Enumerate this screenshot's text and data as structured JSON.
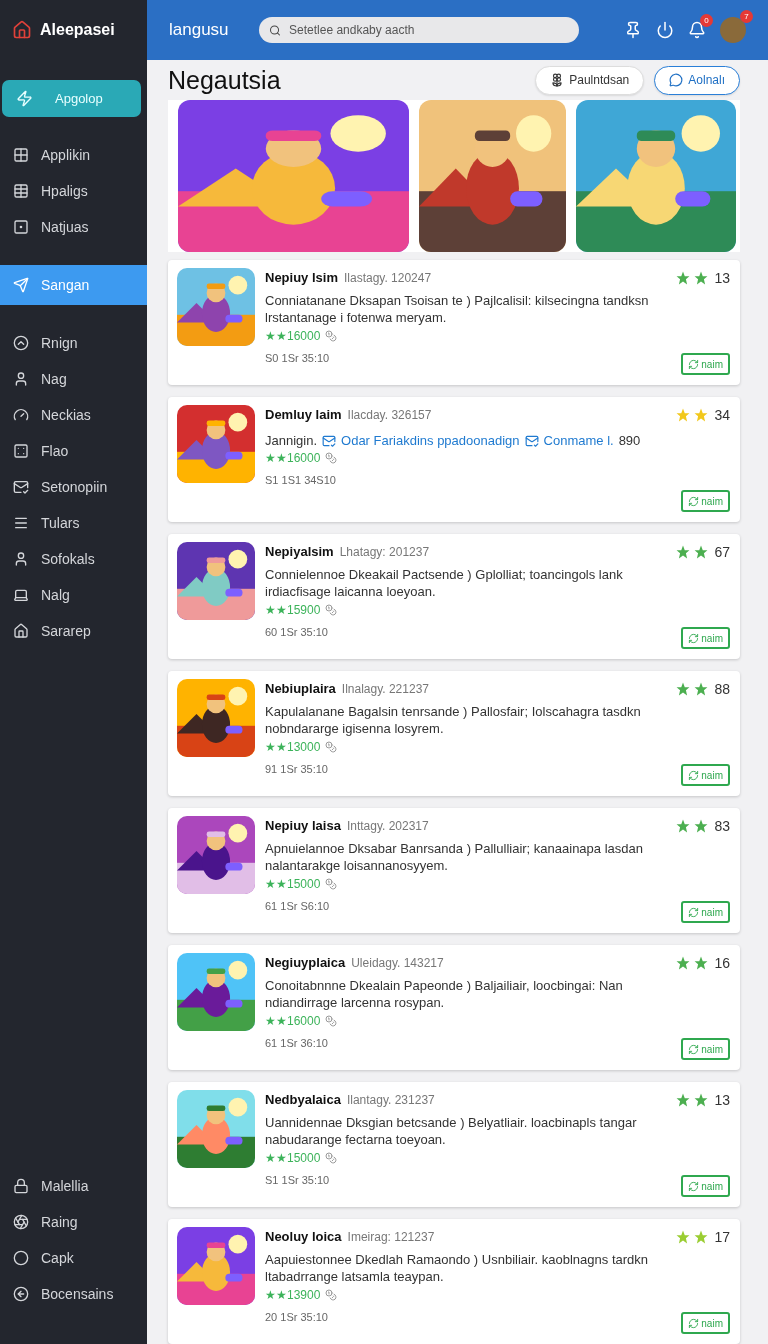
{
  "sidebar": {
    "brand": "Aleepasei",
    "primary_button": "Apgolop",
    "groups": [
      [
        {
          "label": "Applikin",
          "selected": false
        },
        {
          "label": "Hpaligs",
          "selected": false
        },
        {
          "label": "Natjuas",
          "selected": false
        }
      ],
      [
        {
          "label": "Sangan",
          "selected": true
        }
      ],
      [
        {
          "label": "Rnign",
          "selected": false
        },
        {
          "label": "Nag",
          "selected": false
        },
        {
          "label": "Neckias",
          "selected": false
        },
        {
          "label": "Flao",
          "selected": false
        },
        {
          "label": "Setonopiin",
          "selected": false
        },
        {
          "label": "Tulars",
          "selected": false
        },
        {
          "label": "Sofokals",
          "selected": false
        },
        {
          "label": "Nalg",
          "selected": false
        },
        {
          "label": "Sararep",
          "selected": false
        }
      ]
    ],
    "bottom_items": [
      {
        "label": "Malellia",
        "selected": false
      },
      {
        "label": "Raing",
        "selected": false
      },
      {
        "label": "Capk",
        "selected": false
      },
      {
        "label": "Bocensains",
        "selected": false
      }
    ]
  },
  "topbar": {
    "title": "langusu",
    "search": {
      "placeholder": "Setetlee andkaby aacth"
    },
    "notification_badge": "0",
    "avatar_badge": "7"
  },
  "page": {
    "title": "Negautsia",
    "buttons": [
      {
        "label": "Paulntdsan",
        "kind": "plain"
      },
      {
        "label": "Aolnalı",
        "kind": "outlined"
      }
    ]
  },
  "apps": [
    {
      "kind": "text",
      "name": "Nepiuy lsim",
      "date": "Ilastagy. 120247",
      "description": "Conniatanane Dksapan Tsoisan te ) Pajlcalisil: kilsecingna tandksn lrstantanage i fotenwa meryam.",
      "rating": "★★16000",
      "meta": "S0  1Sr 35:10",
      "color": "#4caf50",
      "score": "13",
      "action": "naim"
    },
    {
      "kind": "links",
      "name": "Demluy laim",
      "date": "Ilacday. 326157",
      "lead": "Jannigin.",
      "link_1": "Odar Fariakdins ppadoonadign",
      "link_2": "Conmame l.",
      "tail": "890",
      "rating": "★★16000",
      "meta": "S1  1S1 34S10",
      "color": "#f2c81c",
      "score": "34",
      "action": "naim"
    },
    {
      "kind": "text",
      "name": "Nepiyalsim",
      "date": "Lhatagy: 201237",
      "description": "Connielennoe Dkeakail Pactsende ) Gplolliat; toancingols lank irdiacfisage laicanna loeyoan.",
      "rating": "★★15900",
      "meta": "60  1Sr 35:10",
      "color": "#4caf50",
      "score": "67",
      "action": "naim"
    },
    {
      "kind": "text",
      "name": "Nebiuplaira",
      "date": "Ilnalagy. 221237",
      "description": "Kapulalanane Bagalsin tenrsande ) Pallosfair; Iolscahagra tasdkn nobndararge igisenna losyrem.",
      "rating": "★★13000",
      "meta": "91  1Sr 35:10",
      "color": "#4caf50",
      "score": "88",
      "action": "naim"
    },
    {
      "kind": "text",
      "name": "Nepiuy laisa",
      "date": "Inttagy. 202317",
      "description": "Apnuielannoe Dksabar Banrsanda ) Pallulliair; kanaainapa lasdan nalantarakge loisannanosyyem.",
      "rating": "★★15000",
      "meta": "61  1Sr S6:10",
      "color": "#4caf50",
      "score": "83",
      "action": "naim"
    },
    {
      "kind": "text",
      "name": "Negiuyplaica",
      "date": "Uleidagy. 143217",
      "description": "Conoitabnnne Dkealain Papeonde ) Baljailiair, loocbingai: Nan ndiandirrage larcenna rosypan.",
      "rating": "★★16000",
      "meta": "61  1Sr 36:10",
      "color": "#4caf50",
      "score": "16",
      "action": "naim"
    },
    {
      "kind": "text",
      "name": "Nedbyalaica",
      "date": "Ilantagy. 231237",
      "description": "Uannidennae Dksgian  betcsande ) Belyatliair. loacbinapls tangar nabudarange fectarna toeyoan.",
      "rating": "★★15000",
      "meta": "S1  1Sr 35:10",
      "color": "#4caf50",
      "score": "13",
      "action": "naim"
    },
    {
      "kind": "text",
      "name": "Neoluy loica",
      "date": "Imeirag: 121237",
      "description": "Aapuiestonnee Dkedlah Ramaondo ) Usnbiliair. kaoblnagns tardkn ltabadrrange latsamla teaypan.",
      "rating": "★★13900",
      "meta": "20  1Sr 35:10",
      "color": "#9acd32",
      "score": "17",
      "action": "naim"
    }
  ]
}
